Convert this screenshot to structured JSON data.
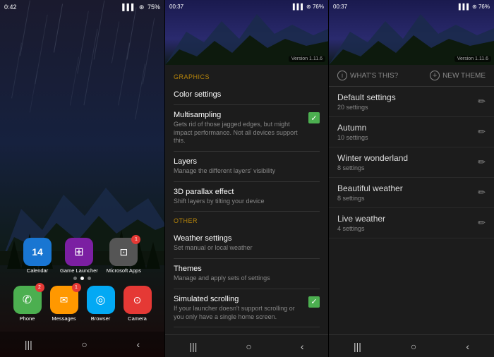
{
  "panel1": {
    "status": {
      "time": "0:42",
      "icons_left": "★ ✦ ●",
      "icons_right": "75%"
    },
    "apps_row1": [
      {
        "label": "Calendar",
        "color": "#1976D2",
        "icon": "14",
        "badge": null
      },
      {
        "label": "Game Launcher",
        "color": "#7B1FA2",
        "icon": "⊞",
        "badge": null
      },
      {
        "label": "Microsoft Apps",
        "color": "#aaa",
        "icon": "⊡",
        "badge": "1"
      }
    ],
    "dots": [
      {
        "active": false
      },
      {
        "active": true
      },
      {
        "active": false
      }
    ],
    "apps_row2": [
      {
        "label": "Phone",
        "color": "#4CAF50",
        "icon": "✆",
        "badge": "2"
      },
      {
        "label": "Messages",
        "color": "#FF9800",
        "icon": "✉",
        "badge": "1"
      },
      {
        "label": "Browser",
        "color": "#03A9F4",
        "icon": "◎",
        "badge": null
      },
      {
        "label": "Camera",
        "color": "#E53935",
        "icon": "⊙",
        "badge": null
      }
    ],
    "nav": [
      "|||",
      "○",
      "‹"
    ]
  },
  "panel2": {
    "status": {
      "time": "00:37",
      "icons_right": "76%"
    },
    "version": "Version 1.11.6",
    "sections": [
      {
        "header": "Graphics",
        "items": [
          {
            "title": "Color settings",
            "desc": "",
            "checkbox": false
          },
          {
            "title": "Multisampling",
            "desc": "Gets rid of those jagged edges, but might impact performance. Not all devices support this.",
            "checkbox": true
          },
          {
            "title": "Layers",
            "desc": "Manage the different layers' visibility",
            "checkbox": false
          },
          {
            "title": "3D parallax effect",
            "desc": "Shift layers by tilting your device",
            "checkbox": false
          }
        ]
      },
      {
        "header": "Other",
        "items": [
          {
            "title": "Weather settings",
            "desc": "Set manual or local weather",
            "checkbox": false
          },
          {
            "title": "Themes",
            "desc": "Manage and apply sets of settings",
            "checkbox": false
          },
          {
            "title": "Simulated scrolling",
            "desc": "If your launcher doesn't support scrolling or you only have a single home screen.",
            "checkbox": true
          }
        ]
      }
    ],
    "nav": [
      "|||",
      "○",
      "‹"
    ]
  },
  "panel3": {
    "status": {
      "time": "00:37",
      "icons_right": "76%"
    },
    "version": "Version 1.11.6",
    "toolbar": {
      "whats_this": "WHAT'S THIS?",
      "new_theme": "NEW THEME"
    },
    "themes": [
      {
        "name": "Default settings",
        "count": "20 settings"
      },
      {
        "name": "Autumn",
        "count": "10 settings"
      },
      {
        "name": "Winter wonderland",
        "count": "8 settings"
      },
      {
        "name": "Beautiful weather",
        "count": "8 settings"
      },
      {
        "name": "Live weather",
        "count": "4 settings"
      }
    ],
    "nav": [
      "|||",
      "○",
      "‹"
    ]
  }
}
